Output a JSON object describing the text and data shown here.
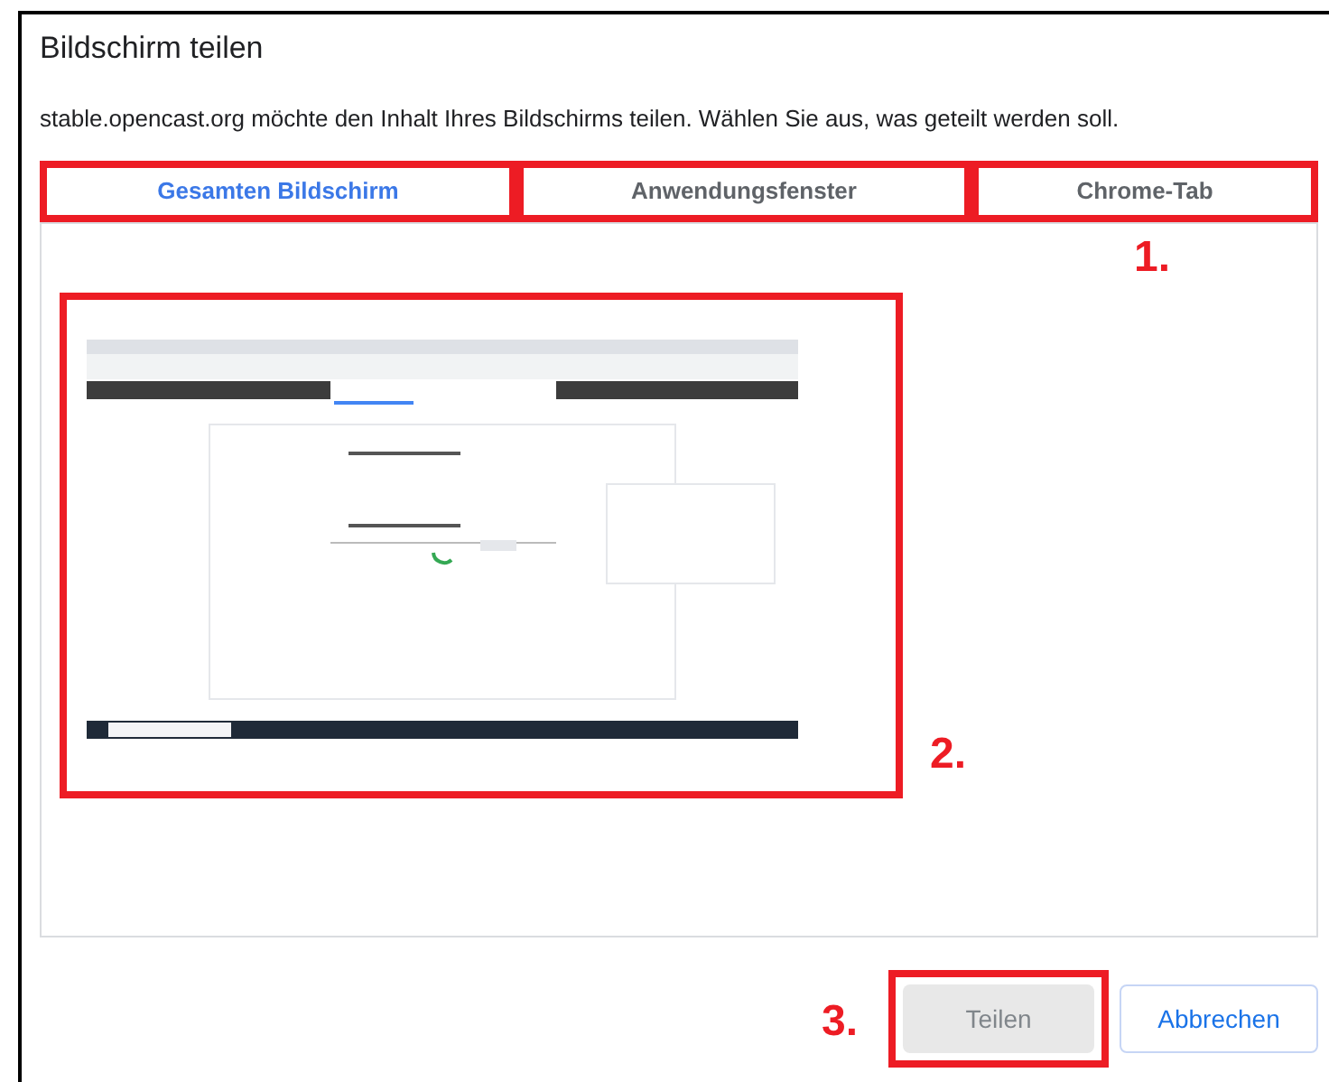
{
  "dialog": {
    "title": "Bildschirm teilen",
    "message": "stable.opencast.org möchte den Inhalt Ihres Bildschirms teilen. Wählen Sie aus, was geteilt werden soll.",
    "tabs_highlighted": true,
    "tabs": [
      {
        "label": "Gesamten Bildschirm",
        "selected": true
      },
      {
        "label": "Anwendungsfenster",
        "selected": false
      },
      {
        "label": "Chrome-Tab",
        "selected": false
      }
    ],
    "preview": {
      "highlighted": true
    },
    "buttons": [
      {
        "label": "Teilen",
        "disabled": true,
        "highlighted": true
      },
      {
        "label": "Abbrechen",
        "disabled": false,
        "highlighted": false
      }
    ]
  },
  "annotations": [
    {
      "label": "1."
    },
    {
      "label": "2."
    },
    {
      "label": "3."
    }
  ]
}
